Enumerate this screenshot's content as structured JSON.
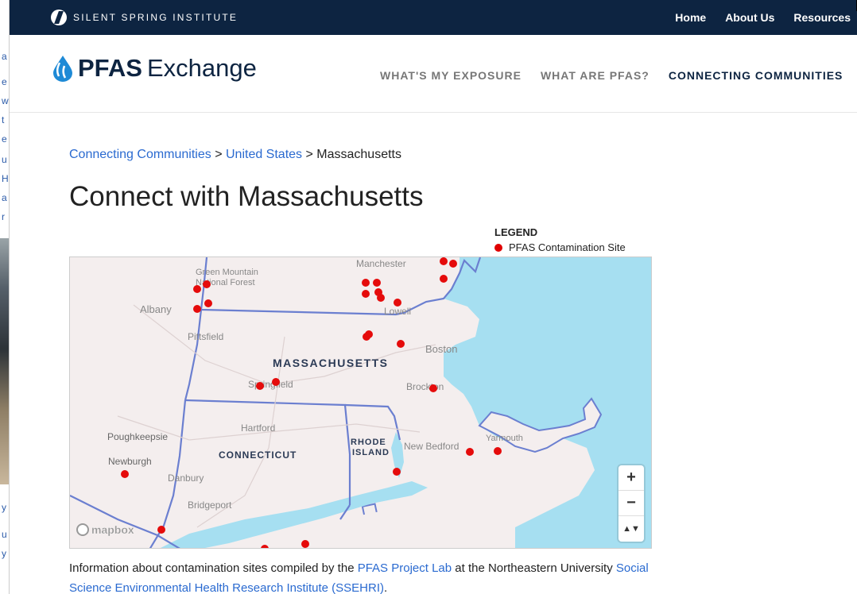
{
  "background_window": {
    "chars": [
      "a",
      "e",
      "w",
      "t",
      "e",
      "u",
      "H",
      "a",
      "r",
      "y",
      "u",
      "y"
    ]
  },
  "topbar": {
    "brand_name": "SILENT SPRING INSTITUTE",
    "nav": [
      "Home",
      "About Us",
      "Resources"
    ]
  },
  "header": {
    "site_title_bold": "PFAS",
    "site_title_light": "Exchange",
    "nav": [
      {
        "label": "WHAT'S MY EXPOSURE",
        "active": false
      },
      {
        "label": "WHAT ARE PFAS?",
        "active": false
      },
      {
        "label": "CONNECTING COMMUNITIES",
        "active": true
      }
    ]
  },
  "breadcrumb": {
    "level1": "Connecting Communities",
    "sep1": " > ",
    "level2": "United States",
    "sep2": " > ",
    "current": "Massachusetts"
  },
  "page_title": "Connect with Massachusetts",
  "legend": {
    "title": "LEGEND",
    "item": "PFAS Contamination Site",
    "dot_color": "#e00000"
  },
  "map": {
    "water_color": "#a6dff1",
    "land_color": "#f4eeee",
    "border_color": "#6b7fd0",
    "state_labels": [
      "MASSACHUSETTS",
      "CONNECTICUT",
      "RHODE",
      "ISLAND"
    ],
    "place_labels": [
      "Green Mountain",
      "National Forest",
      "Manchester",
      "Albany",
      "Lowell",
      "Pittsfield",
      "Boston",
      "Springfield",
      "Brockton",
      "Hartford",
      "Poughkeepsie",
      "New Bedford",
      "Yarmouth",
      "Newburgh",
      "Danbury",
      "Bridgeport"
    ],
    "zoom_in": "+",
    "zoom_out": "−",
    "compass": "▲▼",
    "attribution": "mapbox"
  },
  "info": {
    "text1": "Information about contamination sites compiled by the ",
    "link1": "PFAS Project Lab",
    "text2": " at the Northeastern University ",
    "link2": "Social Science Environmental Health Research Institute (SSEHRI)",
    "text3": "."
  }
}
